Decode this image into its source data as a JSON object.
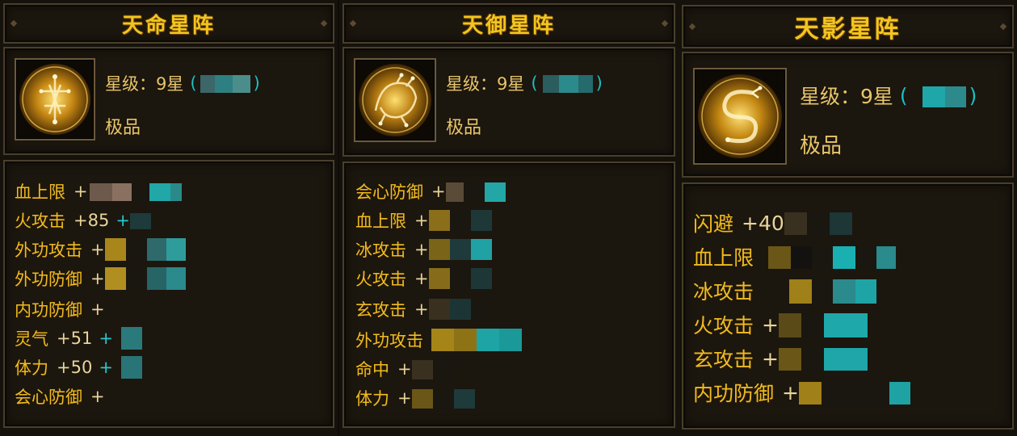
{
  "panels": [
    {
      "title": "天命星阵",
      "star_label": "星级：9星",
      "paren_open": "(",
      "paren_close": ")",
      "quality": "极品",
      "icon": "golden-figure-sigil-icon",
      "stats": [
        {
          "label": "血上限",
          "value": "+",
          "extra": ""
        },
        {
          "label": "火攻击",
          "value": "+85",
          "extra": "+"
        },
        {
          "label": "外功攻击",
          "value": "+",
          "extra": ""
        },
        {
          "label": "外功防御",
          "value": "+",
          "extra": ""
        },
        {
          "label": "内功防御",
          "value": "+",
          "extra": ""
        },
        {
          "label": "灵气",
          "value": "+51",
          "extra": "+"
        },
        {
          "label": "体力",
          "value": "+50",
          "extra": "+"
        },
        {
          "label": "会心防御",
          "value": "+",
          "extra": ""
        }
      ]
    },
    {
      "title": "天御星阵",
      "star_label": "星级：9星",
      "paren_open": "(",
      "paren_close": ")",
      "quality": "极品",
      "icon": "golden-beast-sigil-icon",
      "stats": [
        {
          "label": "会心防御",
          "value": "+",
          "extra": ""
        },
        {
          "label": "血上限",
          "value": "+",
          "extra": ""
        },
        {
          "label": "冰攻击",
          "value": "+",
          "extra": ""
        },
        {
          "label": "火攻击",
          "value": "+",
          "extra": ""
        },
        {
          "label": "玄攻击",
          "value": "+",
          "extra": ""
        },
        {
          "label": "外功攻击",
          "value": "",
          "extra": ""
        },
        {
          "label": "命中",
          "value": "+",
          "extra": ""
        },
        {
          "label": "体力",
          "value": "+",
          "extra": ""
        }
      ]
    },
    {
      "title": "天影星阵",
      "star_label": "星级：9星",
      "paren_open": "(",
      "paren_close": ")",
      "quality": "极品",
      "icon": "golden-dragon-sigil-icon",
      "stats": [
        {
          "label": "闪避",
          "value": "+40",
          "extra": ""
        },
        {
          "label": "血上限",
          "value": "",
          "extra": ""
        },
        {
          "label": "冰攻击",
          "value": "",
          "extra": ""
        },
        {
          "label": "火攻击",
          "value": "+",
          "extra": ""
        },
        {
          "label": "玄攻击",
          "value": "+",
          "extra": ""
        },
        {
          "label": "内功防御",
          "value": "+",
          "extra": ""
        }
      ]
    }
  ],
  "colors": {
    "title_gold": "#f2c522",
    "stat_gold": "#f0bb22",
    "info_gold": "#e8c56a",
    "cyan": "#19c0c4",
    "frame": "#4a3e2b"
  }
}
